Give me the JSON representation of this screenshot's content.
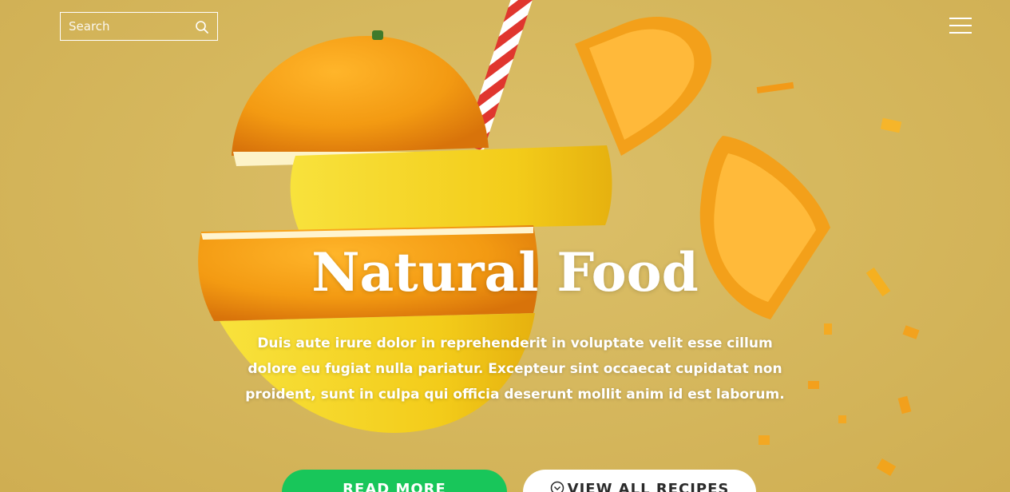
{
  "search": {
    "placeholder": "Search"
  },
  "hero": {
    "title": "Natural Food",
    "text": "Duis aute irure dolor in reprehenderit in voluptate velit esse cillum dolore eu fugiat nulla pariatur. Excepteur sint occaecat cupidatat non proident, sunt in culpa qui officia deserunt mollit anim id est laborum."
  },
  "buttons": {
    "read_more": "READ MORE",
    "view_all": "VIEW ALL RECIPES"
  },
  "icons": {
    "search": "search-icon",
    "menu": "hamburger-menu-icon",
    "view_all": "chevron-circle-icon"
  },
  "colors": {
    "background": "#d4b65a",
    "orange": "#f39a12",
    "lemon": "#f6d31e",
    "primary_button": "#18c65a",
    "text": "#ffffff"
  }
}
